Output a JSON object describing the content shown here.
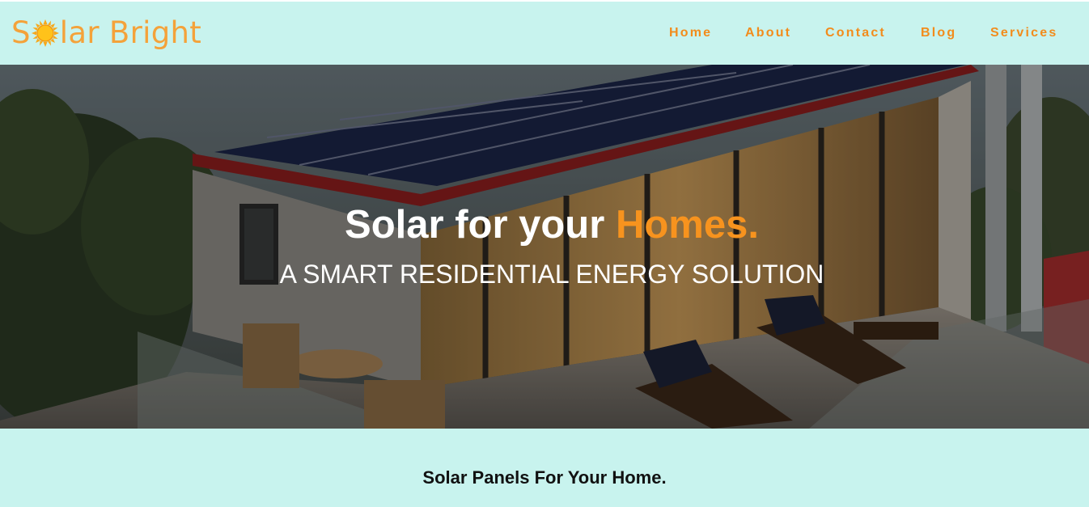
{
  "brand": {
    "name_before": "S",
    "name_after": "lar Bright",
    "accent_color": "#f4a23a",
    "icon": "sun-icon"
  },
  "nav": {
    "items": [
      {
        "label": "Home"
      },
      {
        "label": "About"
      },
      {
        "label": "Contact"
      },
      {
        "label": "Blog"
      },
      {
        "label": "Services"
      }
    ],
    "link_color": "#f28c1c"
  },
  "hero": {
    "title_main": "Solar for your",
    "title_accent": "Homes.",
    "subtitle": "A SMART RESIDENTIAL ENERGY SOLUTION",
    "image": "house-with-rooftop-solar-panels-photo",
    "accent_color": "#f7931e"
  },
  "section": {
    "heading": "Solar Panels For Your Home."
  },
  "colors": {
    "page_background": "#c8f3ee"
  }
}
